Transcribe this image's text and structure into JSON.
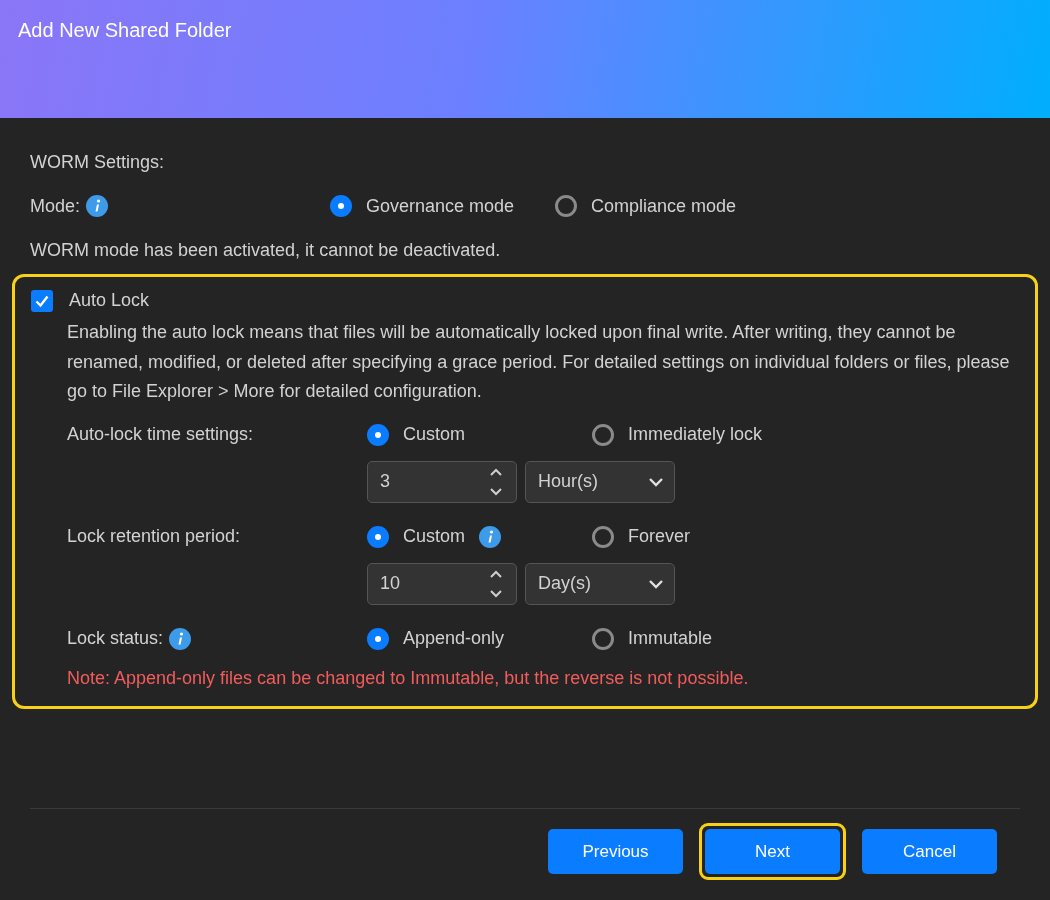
{
  "dialog": {
    "title": "Add New Shared Folder"
  },
  "worm": {
    "heading": "WORM Settings:",
    "mode_label": "Mode:",
    "mode_has_info": true,
    "modes": [
      {
        "label": "Governance mode",
        "selected": true,
        "has_info": false
      },
      {
        "label": "Compliance mode",
        "selected": false,
        "has_info": false
      }
    ],
    "notice": "WORM mode has been activated, it cannot be deactivated."
  },
  "auto_lock": {
    "label": "Auto Lock",
    "checked": true,
    "highlighted": true,
    "description": "Enabling the auto lock means that files will be automatically locked upon final write. After writing, they cannot be renamed, modified, or deleted after specifying a grace period. For detailed settings on individual folders or files, please go to File Explorer > More for detailed configuration.",
    "settings": [
      {
        "label": "Auto-lock time settings:",
        "has_info": false,
        "options": [
          {
            "label": "Custom",
            "selected": true,
            "has_info": false
          },
          {
            "label": "Immediately lock",
            "selected": false,
            "has_info": false
          }
        ],
        "amount": "3",
        "unit": "Hour(s)"
      },
      {
        "label": "Lock retention period:",
        "has_info": false,
        "options": [
          {
            "label": "Custom",
            "selected": true,
            "has_info": true
          },
          {
            "label": "Forever",
            "selected": false,
            "has_info": false
          }
        ],
        "amount": "10",
        "unit": "Day(s)"
      },
      {
        "label": "Lock status:",
        "has_info": true,
        "options": [
          {
            "label": "Append-only",
            "selected": true,
            "has_info": false
          },
          {
            "label": "Immutable",
            "selected": false,
            "has_info": false
          }
        ]
      }
    ],
    "note": "Note: Append-only files can be changed to Immutable, but the reverse is not possible."
  },
  "buttons": [
    {
      "label": "Previous",
      "highlighted": false
    },
    {
      "label": "Next",
      "highlighted": true
    },
    {
      "label": "Cancel",
      "highlighted": false
    }
  ]
}
